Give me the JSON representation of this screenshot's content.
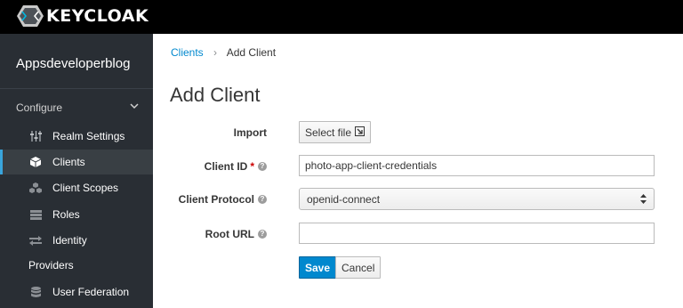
{
  "header": {
    "brand": "KEYCLOAK",
    "logo_icon": "keycloak-logo-icon"
  },
  "sidebar": {
    "realm": "Appsdeveloperblog",
    "section": "Configure",
    "section_icon": "chevron-down-icon",
    "items": [
      {
        "label": "Realm Settings",
        "icon": "sliders-icon"
      },
      {
        "label": "Clients",
        "icon": "cube-icon",
        "active": true
      },
      {
        "label": "Client Scopes",
        "icon": "cubes-icon"
      },
      {
        "label": "Roles",
        "icon": "list-icon"
      },
      {
        "label": "Identity",
        "icon": "exchange-icon"
      },
      {
        "label": "Providers"
      },
      {
        "label": "User Federation",
        "icon": "database-icon"
      }
    ]
  },
  "breadcrumb": {
    "parent": "Clients",
    "separator": "›",
    "current": "Add Client"
  },
  "page": {
    "title": "Add Client"
  },
  "form": {
    "import_label": "Import",
    "import_button": "Select file",
    "client_id_label": "Client ID",
    "required_mark": "*",
    "client_id_value": "photo-app-client-credentials",
    "protocol_label": "Client Protocol",
    "protocol_value": "openid-connect",
    "root_url_label": "Root URL",
    "root_url_value": "",
    "save_button": "Save",
    "cancel_button": "Cancel",
    "help_glyph": "?"
  },
  "colors": {
    "accent": "#0088ce",
    "sidebar_bg": "#292e34",
    "active_bar": "#39a5dc"
  }
}
